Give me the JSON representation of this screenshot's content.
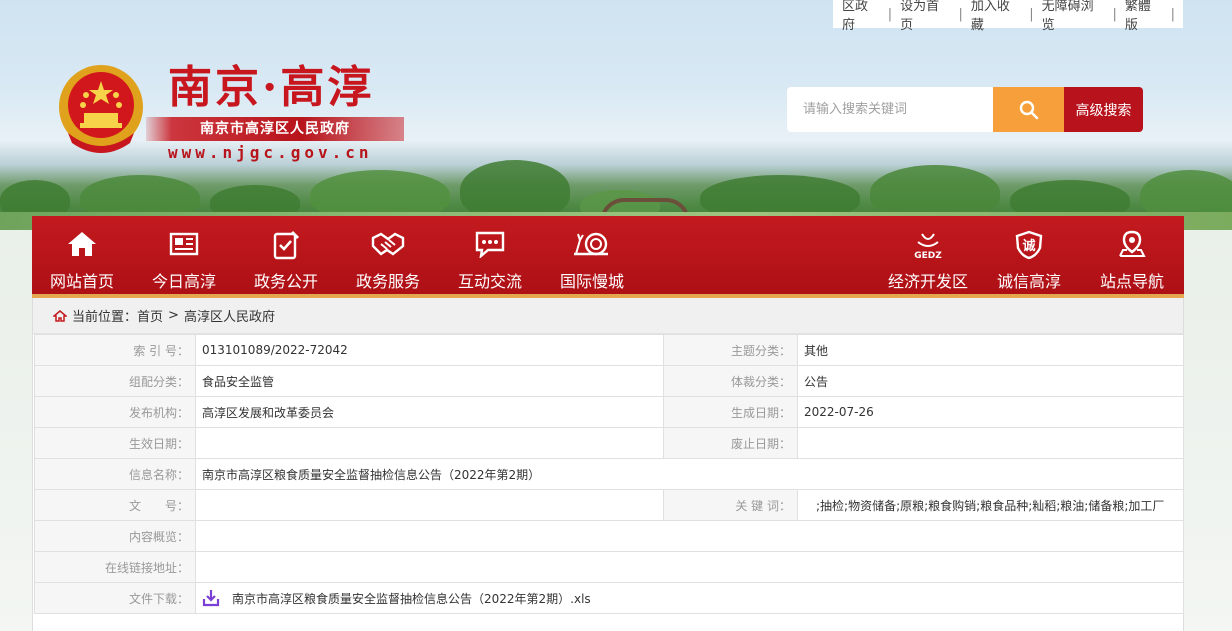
{
  "top_links": [
    "区政府",
    "设为首页",
    "加入收藏",
    "无障碍浏览",
    "繁體版"
  ],
  "header": {
    "site_title": "南京·高淳",
    "gov_name": "南京市高淳区人民政府",
    "url": "www.njgc.gov.cn"
  },
  "search": {
    "placeholder": "请输入搜索关键词",
    "advanced_label": "高级搜索"
  },
  "nav": {
    "items": [
      {
        "label": "网站首页",
        "icon": "home-icon"
      },
      {
        "label": "今日高淳",
        "icon": "newspaper-icon"
      },
      {
        "label": "政务公开",
        "icon": "checklist-icon"
      },
      {
        "label": "政务服务",
        "icon": "handshake-icon"
      },
      {
        "label": "互动交流",
        "icon": "chat-icon"
      },
      {
        "label": "国际慢城",
        "icon": "snail-icon"
      },
      {
        "label": "经济开发区",
        "icon": "gedz-logo-icon",
        "badge": "GEDZ"
      },
      {
        "label": "诚信高淳",
        "icon": "shield-icon",
        "badge": "诚"
      },
      {
        "label": "站点导航",
        "icon": "map-pin-icon"
      }
    ]
  },
  "breadcrumb": {
    "label": "当前位置：",
    "home": "首页",
    "sep": ">",
    "current": "高淳区人民政府"
  },
  "meta": {
    "index_no_label": "索 引 号：",
    "index_no": "013101089/2022-72042",
    "topic_label": "主题分类：",
    "topic": "其他",
    "org_cat_label": "组配分类：",
    "org_cat": "食品安全监管",
    "genre_label": "体裁分类：",
    "genre": "公告",
    "publisher_label": "发布机构：",
    "publisher": "高淳区发展和改革委员会",
    "created_label": "生成日期：",
    "created": "2022-07-26",
    "effective_label": "生效日期：",
    "effective": "",
    "abolished_label": "废止日期：",
    "abolished": "",
    "title_label": "信息名称：",
    "title": "南京市高淳区粮食质量安全监督抽检信息公告（2022年第2期）",
    "docno_label": "文　　号：",
    "docno": "",
    "keywords_label": "关 键 词：",
    "keywords": ";抽检;物资储备;原粮;粮食购销;粮食品种;籼稻;粮油;储备粮;加工厂",
    "summary_label": "内容概览：",
    "summary": "",
    "link_label": "在线链接地址：",
    "link": "",
    "download_label": "文件下载：",
    "download_file": "南京市高淳区粮食质量安全监督抽检信息公告（2022年第2期）.xls"
  },
  "colors": {
    "brand_red": "#c31a1f",
    "search_orange": "#f7a03b",
    "nav_underline": "#e4a74e",
    "download_icon": "#7b3fd6"
  }
}
